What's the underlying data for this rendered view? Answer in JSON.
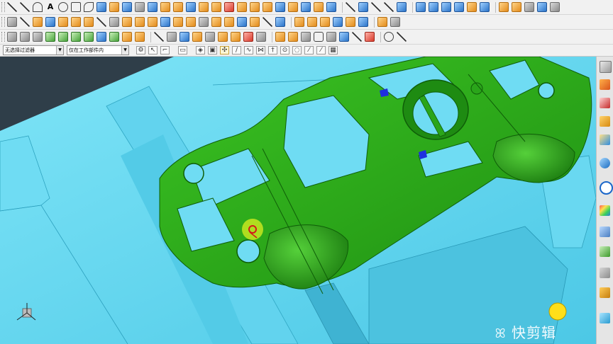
{
  "filter_bar": {
    "type_filter": "无选择过滤器",
    "scope_filter": "仅在工作部件内"
  },
  "toolbar_rows": [
    {
      "icons": [
        "line-icon",
        "arc-icon",
        "arc-icon",
        "text-icon",
        "circle-icon",
        "rectangle-icon",
        "spline-icon",
        "point-icon",
        "sketch-icon",
        "offset-curve-icon",
        "project-curve-icon",
        "bridge-curve-icon",
        "extrude-icon",
        "revolve-icon",
        "surface-icon",
        "block-icon",
        "cylinder-icon",
        "cone-icon",
        "sphere-icon",
        "union-icon",
        "subtract-icon",
        "intersect-icon",
        "fillet-icon",
        "chamfer-icon",
        "shell-icon",
        "draft-icon",
        "trim-body-icon",
        "mirror-icon",
        "pattern-icon",
        "measure-icon",
        "sweep-icon",
        "through-curves-icon",
        "n-sided-icon",
        "trim-sheet-icon",
        "sew-icon",
        "extend-icon",
        "thicken-icon",
        "section-icon",
        "offset-face-icon",
        "delete-face-icon",
        "replace-face-icon",
        "move-face-icon",
        "resize-icon",
        "extract-icon",
        "layer-icon",
        "view-icon"
      ]
    },
    {
      "icons": [
        "layer-settings-icon",
        "measure-icon",
        "arrow-left-icon",
        "arrow-right-icon",
        "move-icon",
        "rotate-icon",
        "wcs-icon",
        "csys-icon",
        "point-icon",
        "plane-icon",
        "datum-axis-icon",
        "split-body-icon",
        "hole-icon",
        "boss-icon",
        "pocket-icon",
        "pad-icon",
        "slot-icon",
        "groove-icon",
        "emboss-icon",
        "rib-icon",
        "analysis-icon",
        "deviation-icon",
        "curvature-icon",
        "reflection-icon",
        "hexagon-icon",
        "mold-icon",
        "magnet-icon",
        "insert-icon",
        "ejector-icon",
        "cooling-icon",
        "gate-icon",
        "settings-icon"
      ]
    }
  ],
  "snap_icons": [
    "end-point-icon",
    "mid-point-icon",
    "control-point-icon",
    "intersection-icon",
    "arc-center-icon",
    "tangent-icon",
    "quadrant-icon",
    "point-on-curve-icon",
    "point-on-face-icon",
    "bounded-grid-icon"
  ],
  "resource_bar_icons": [
    "part-navigator-icon",
    "assembly-navigator-icon",
    "constraint-navigator-icon",
    "reuse-library-icon",
    "hd3d-icon",
    "web-browser-icon",
    "history-icon",
    "palette-icon",
    "system-materials-icon",
    "role-icon",
    "process-studio-icon",
    "manufacturing-wizard-icon"
  ],
  "colors": {
    "part_green": "#2ea81a",
    "mold_cyan": "#58d7f2",
    "background": "#2f3e49",
    "cursor_marker": "#c7e620",
    "bubble_yellow": "#ffdf1a"
  },
  "watermark": "快剪辑"
}
